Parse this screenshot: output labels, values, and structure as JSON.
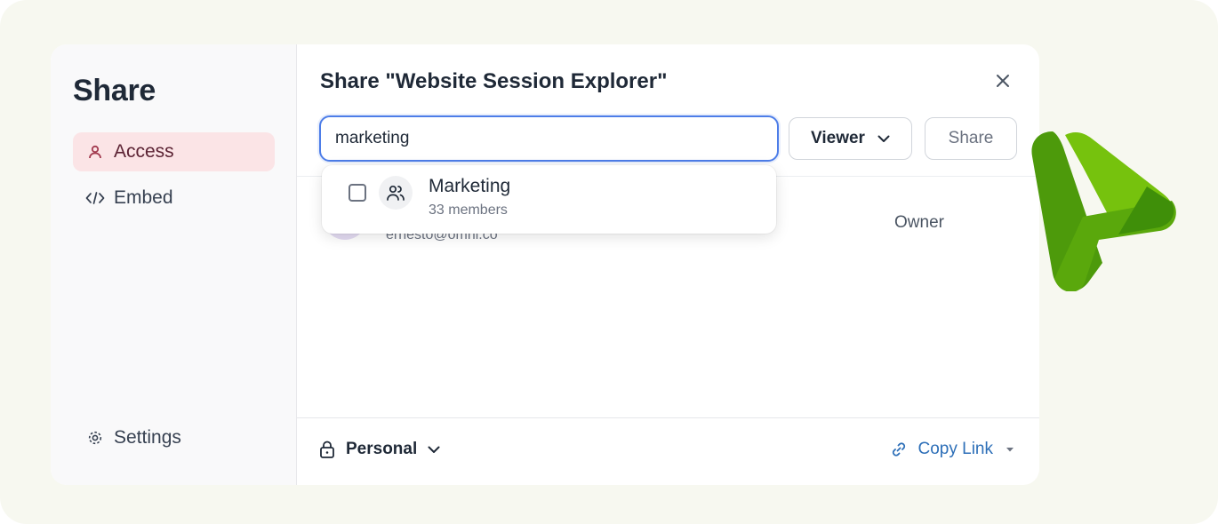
{
  "sidebar": {
    "title": "Share",
    "items": [
      {
        "label": "Access",
        "icon": "user-icon",
        "active": true
      },
      {
        "label": "Embed",
        "icon": "code-icon",
        "active": false
      }
    ],
    "settings_label": "Settings"
  },
  "dialog": {
    "title": "Share \"Website Session Explorer\"",
    "search_value": "marketing",
    "role_label": "Viewer",
    "share_label": "Share"
  },
  "member": {
    "email": "ernesto@omni.co",
    "role": "Owner"
  },
  "dropdown": {
    "items": [
      {
        "name": "Marketing",
        "sub": "33 members",
        "icon": "group-icon"
      }
    ]
  },
  "footer": {
    "access_label": "Personal",
    "copy_link_label": "Copy Link"
  },
  "colors": {
    "accent": "#4d7de8",
    "active_nav_bg": "#fbe4e6",
    "link": "#2d6fb8",
    "logo_green": "#6bbf0c"
  }
}
